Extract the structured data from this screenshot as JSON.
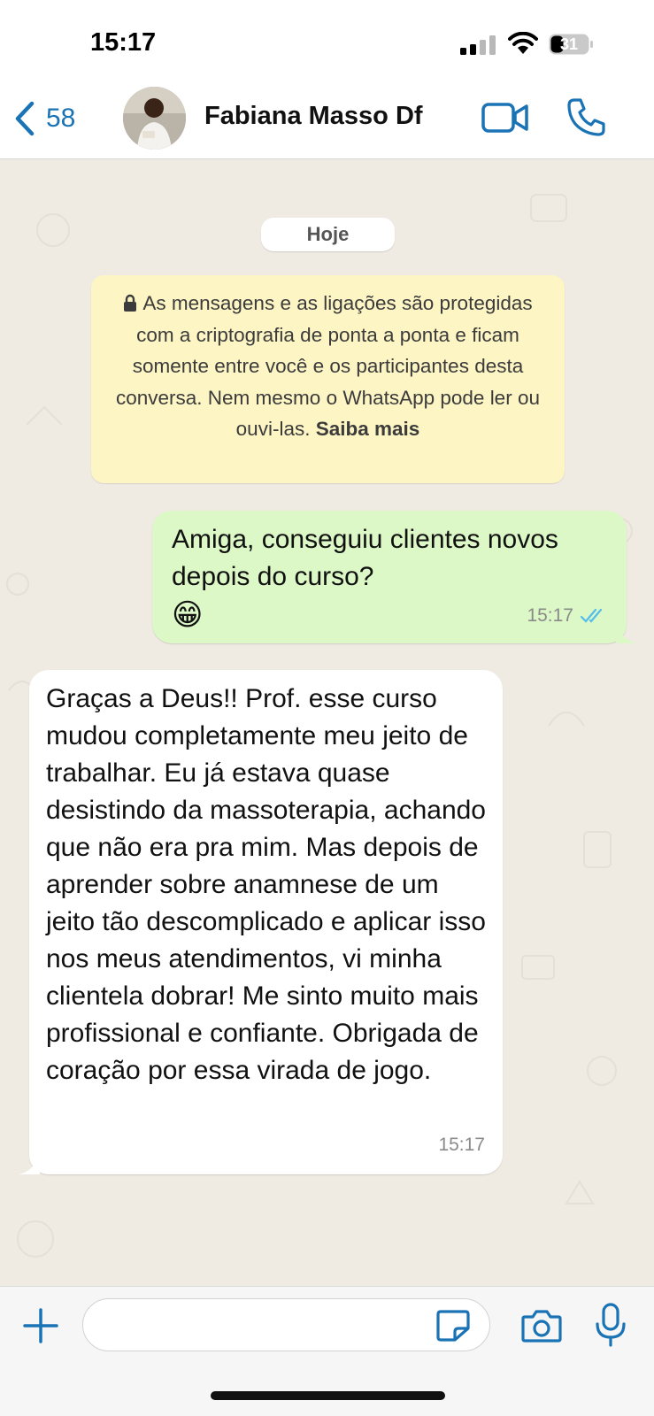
{
  "status_bar": {
    "time": "15:17",
    "battery": "31"
  },
  "header": {
    "back_count": "58",
    "contact_name": "Fabiana Masso Df"
  },
  "chat": {
    "date_label": "Hoje",
    "system_notice": {
      "text": "As mensagens e as ligações são protegidas com a criptografia de ponta a ponta e ficam somente entre você e os participantes desta conversa. Nem mesmo o WhatsApp pode ler ou ouvi-las.",
      "link": "Saiba mais"
    },
    "messages": [
      {
        "direction": "outgoing",
        "text": "Amiga, conseguiu clientes novos depois do curso?",
        "emoji": "😁",
        "time": "15:17",
        "status": "read"
      },
      {
        "direction": "incoming",
        "text": "Graças a Deus!! Prof. esse curso mudou completamente meu jeito de trabalhar. Eu já estava quase desistindo da massoterapia, achando que não era pra mim. Mas depois de aprender sobre anamnese de um jeito tão descomplicado e aplicar isso nos meus atendimentos, vi minha clientela dobrar! Me sinto muito mais profissional e confiante. Obrigada de coração por essa virada de jogo.",
        "time": "15:17"
      }
    ]
  },
  "input_bar": {
    "value": ""
  },
  "colors": {
    "accent": "#1a73b5",
    "outgoing_bubble": "#dcf8c6",
    "incoming_bubble": "#ffffff",
    "notice_bg": "#fdf5c4",
    "read_ticks": "#53bdeb"
  }
}
